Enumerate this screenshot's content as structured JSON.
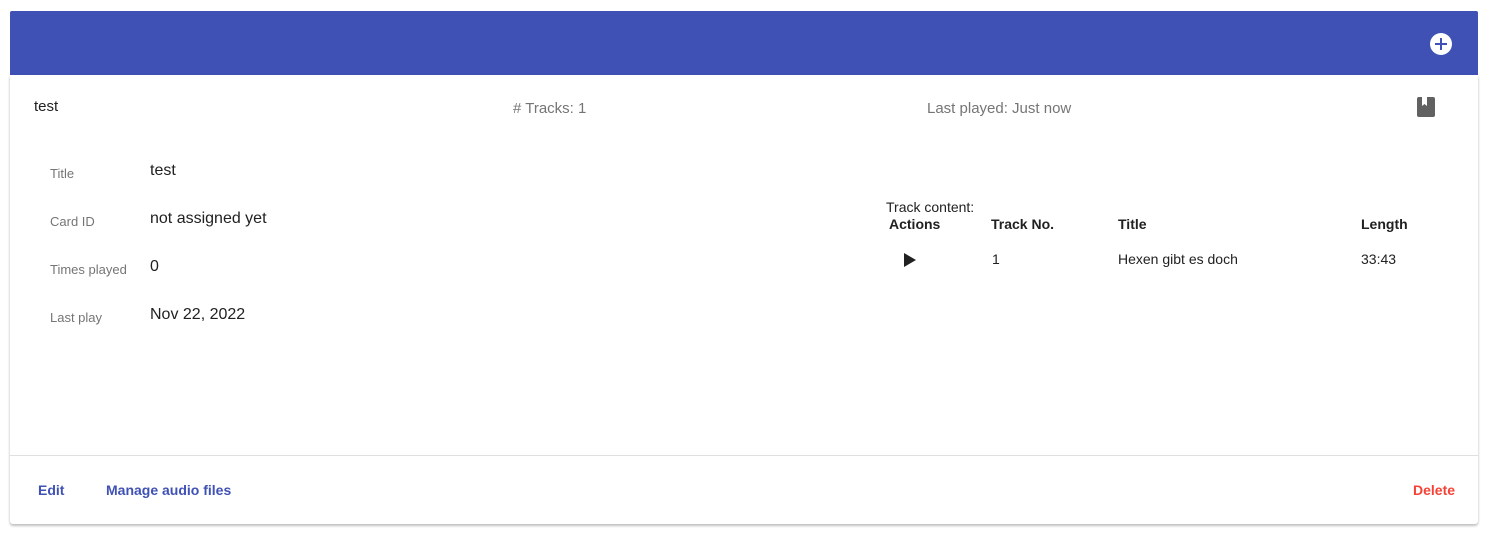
{
  "toolbar": {
    "add_icon": "add-circle-icon",
    "color": "#3f51b5"
  },
  "card": {
    "header": {
      "title": "test",
      "tracks": "# Tracks: 1",
      "last_played": "Last played: Just now",
      "icon": "book-icon"
    },
    "details": [
      {
        "label": "Title",
        "value": "test"
      },
      {
        "label": "Card ID",
        "value": "not assigned yet"
      },
      {
        "label": "Times played",
        "value": "0"
      },
      {
        "label": "Last play",
        "value": "Nov 22, 2022"
      }
    ],
    "track_content": {
      "caption": "Track content:",
      "columns": [
        "Actions",
        "Track No.",
        "Title",
        "Length"
      ],
      "rows": [
        {
          "action_icon": "play-icon",
          "track_no": "1",
          "title": "Hexen gibt es doch",
          "length": "33:43"
        }
      ]
    },
    "actions": {
      "edit": "Edit",
      "manage": "Manage audio files",
      "delete": "Delete"
    }
  },
  "colors": {
    "accent": "#3f51b5",
    "danger": "#f44336"
  }
}
